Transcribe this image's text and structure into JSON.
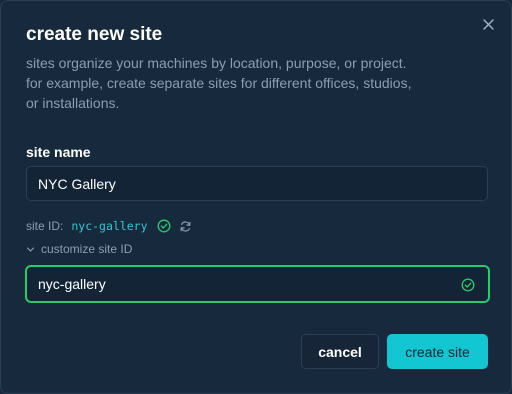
{
  "dialog": {
    "title": "create new site",
    "description_lines": [
      "sites organize your machines by location, purpose, or project.",
      "for example, create separate sites for different offices, studios,",
      "or installations."
    ]
  },
  "site_name": {
    "label": "site name",
    "value": "NYC Gallery"
  },
  "site_id": {
    "label": "site ID:",
    "value": "nyc-gallery",
    "customize_label": "customize site ID",
    "custom_value": "nyc-gallery"
  },
  "buttons": {
    "cancel": "cancel",
    "create": "create site"
  },
  "icons": {
    "close": "close-icon",
    "valid": "check-circle-icon",
    "refresh": "refresh-icon",
    "expand": "chevron-down-icon"
  },
  "colors": {
    "accent": "#12c6d2",
    "success": "#2bcb6a",
    "background": "#172a3d"
  }
}
